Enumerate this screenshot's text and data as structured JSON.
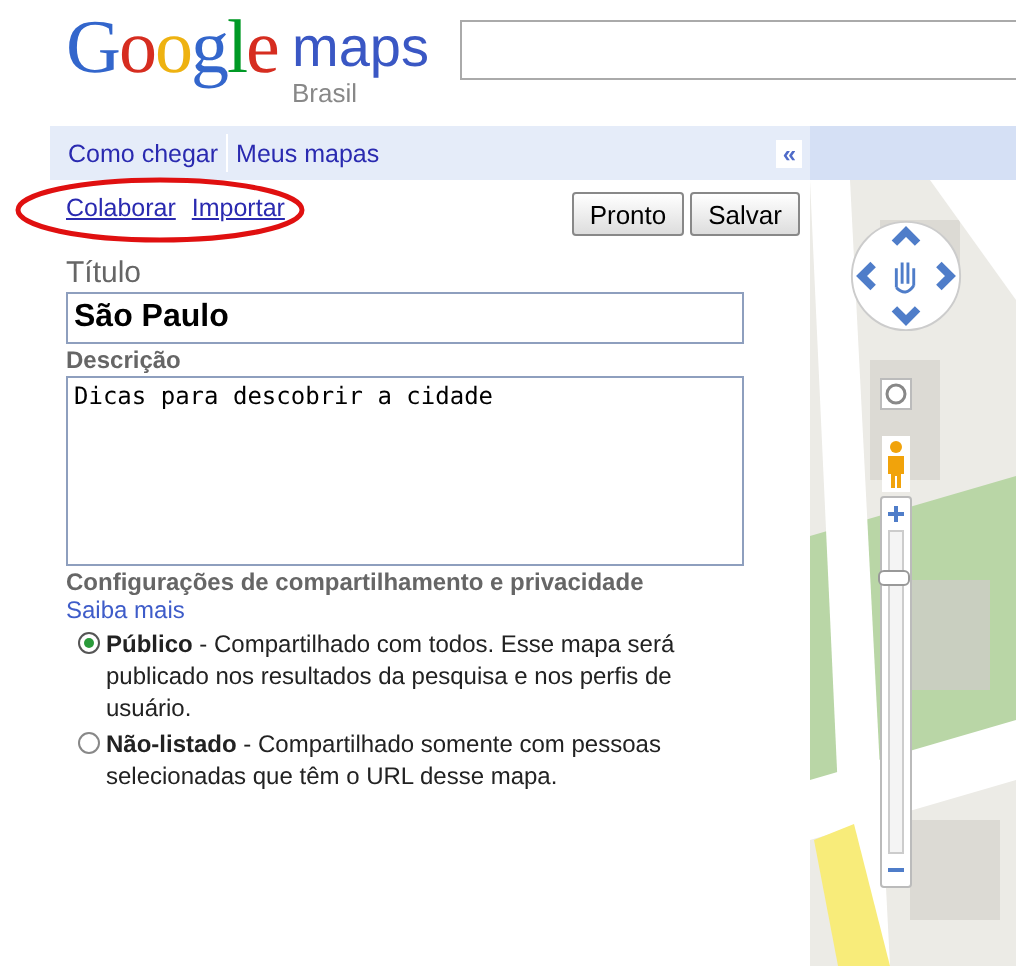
{
  "logo": {
    "word": "Google",
    "product": "maps",
    "region": "Brasil"
  },
  "nav": {
    "links": [
      "Como chegar",
      "Meus mapas"
    ],
    "collapse": "«"
  },
  "actions": {
    "links": [
      "Colaborar",
      "Importar"
    ],
    "buttons": [
      "Pronto",
      "Salvar"
    ]
  },
  "form": {
    "title_label": "Título",
    "title_value": "São Paulo",
    "description_label": "Descrição",
    "description_value": "Dicas para descobrir a cidade"
  },
  "privacy": {
    "heading": "Configurações de compartilhamento e privacidade",
    "learn_more": "Saiba mais",
    "options": [
      {
        "name": "Público",
        "text": " - Compartilhado com todos. Esse mapa será publicado nos resultados da pesquisa e nos perfis de usuário.",
        "selected": true
      },
      {
        "name": "Não-listado",
        "text": " - Compartilhado somente com pessoas selecionadas que têm o URL desse mapa.",
        "selected": false
      }
    ]
  },
  "map": {
    "zoom": {
      "level": 0.88
    }
  }
}
